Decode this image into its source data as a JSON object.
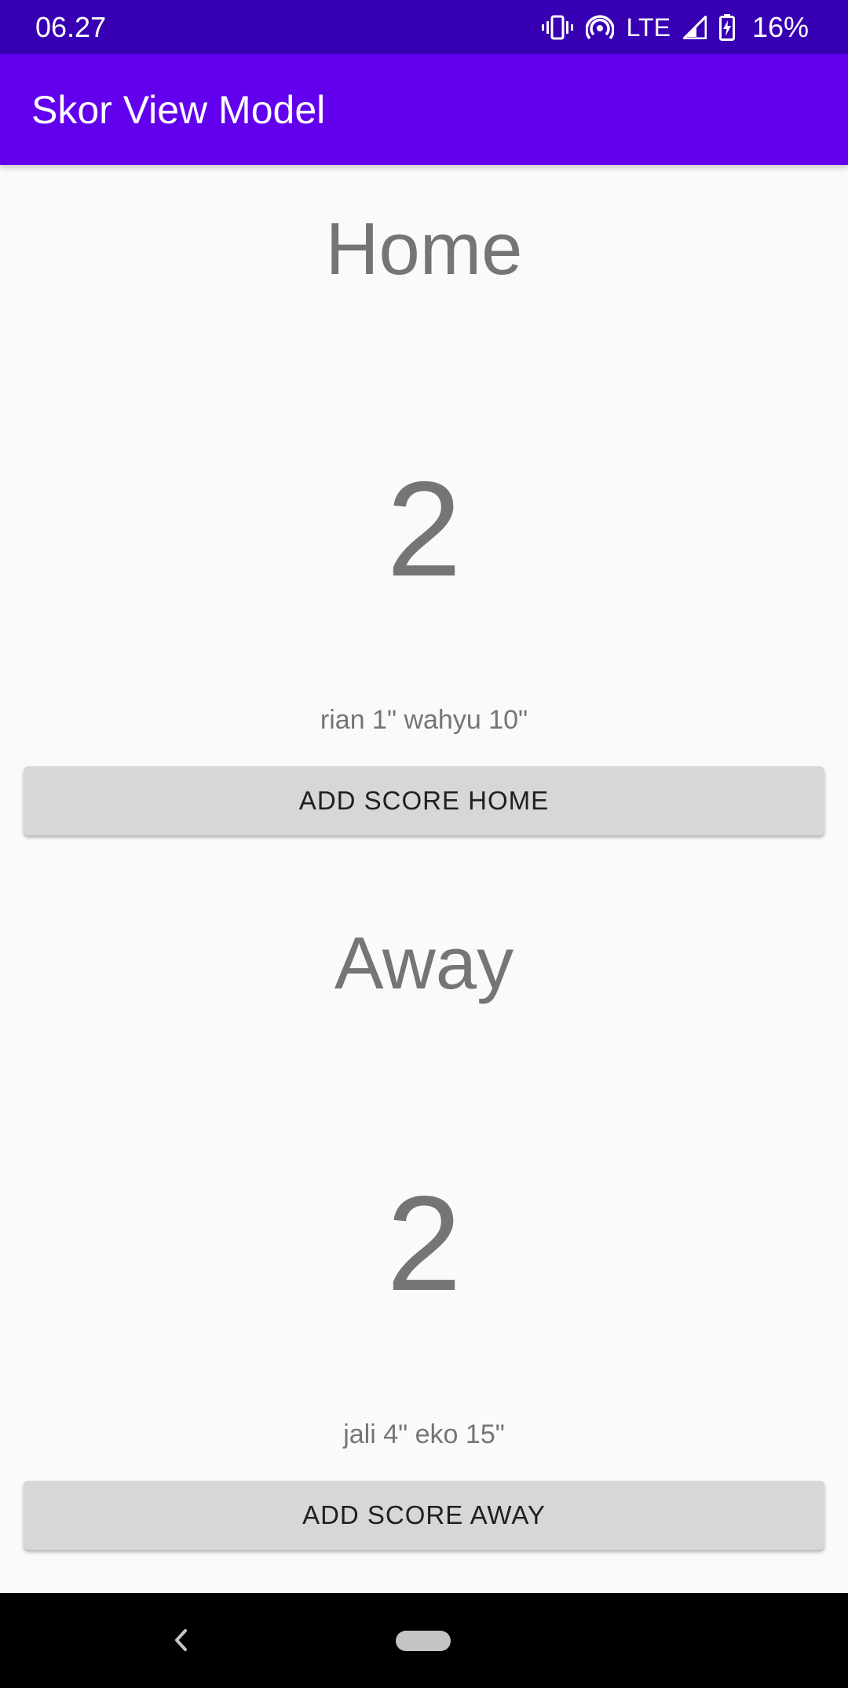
{
  "status_bar": {
    "time": "06.27",
    "network_label": "LTE",
    "battery_percent": "16%",
    "icons": [
      "vibrate-icon",
      "hotspot-icon",
      "signal-icon",
      "battery-charging-icon"
    ]
  },
  "app_bar": {
    "title": "Skor View Model",
    "color": "#6200ee",
    "status_color": "#3700b3"
  },
  "home": {
    "label": "Home",
    "score": "2",
    "scorers": "rian 1\" wahyu 10\"",
    "button_label": "ADD SCORE HOME"
  },
  "away": {
    "label": "Away",
    "score": "2",
    "scorers": "jali 4\" eko 15\"",
    "button_label": "ADD SCORE AWAY"
  },
  "nav_bar": {
    "icons": [
      "back-icon",
      "home-pill-icon"
    ]
  }
}
